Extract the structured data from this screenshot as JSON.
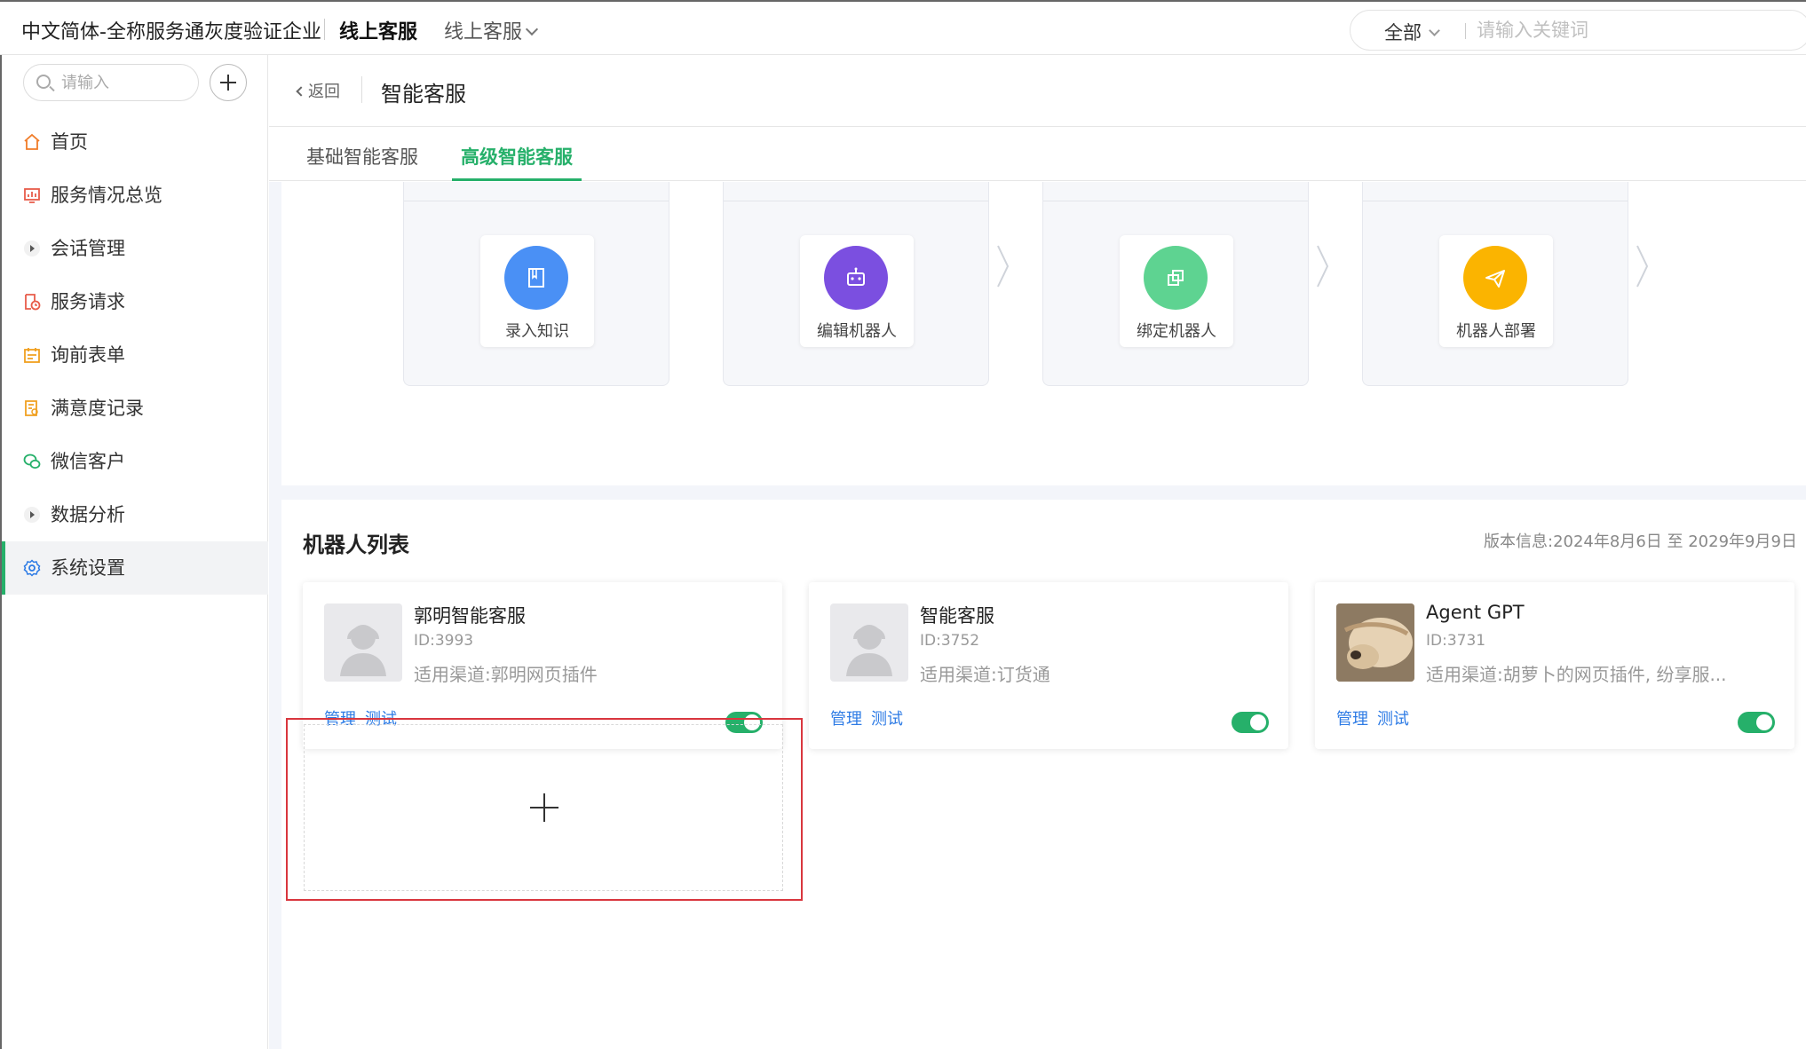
{
  "header": {
    "company": "中文简体-全称服务通灰度验证企业",
    "product": "线上客服",
    "product_switch": "线上客服",
    "scope": "全部",
    "search_placeholder": "请输入关键词"
  },
  "sidebar": {
    "search_placeholder": "请输入",
    "items": [
      {
        "label": "首页",
        "icon": "home-icon",
        "color": "#f07c28"
      },
      {
        "label": "服务情况总览",
        "icon": "dashboard-icon",
        "color": "#e85c4a"
      },
      {
        "label": "会话管理",
        "icon": "caret-right-icon",
        "color": "#555555"
      },
      {
        "label": "服务请求",
        "icon": "document-clock-icon",
        "color": "#e85c4a"
      },
      {
        "label": "询前表单",
        "icon": "calendar-form-icon",
        "color": "#f0a020"
      },
      {
        "label": "满意度记录",
        "icon": "rating-doc-icon",
        "color": "#f0a020"
      },
      {
        "label": "微信客户",
        "icon": "wechat-icon",
        "color": "#26b06a"
      },
      {
        "label": "数据分析",
        "icon": "caret-right-icon",
        "color": "#555555"
      },
      {
        "label": "系统设置",
        "icon": "gear-icon",
        "color": "#2d7be5"
      }
    ]
  },
  "page": {
    "back_label": "返回",
    "title": "智能客服",
    "tabs": [
      "基础智能客服",
      "高级智能客服"
    ],
    "active_tab": "高级智能客服"
  },
  "flow_steps": [
    {
      "label": "录入知识",
      "icon": "book-icon",
      "color": "#4a90f5"
    },
    {
      "label": "编辑机器人",
      "icon": "robot-icon",
      "color": "#7b4fe0"
    },
    {
      "label": "绑定机器人",
      "icon": "bind-icon",
      "color": "#5ed391"
    },
    {
      "label": "机器人部署",
      "icon": "send-icon",
      "color": "#fbb400"
    }
  ],
  "robot_list": {
    "title": "机器人列表",
    "version_label": "版本信息:",
    "version_range": "2024年8月6日 至 2029年9月9日",
    "robots": [
      {
        "name": "郭明智能客服",
        "id": "ID:3993",
        "channel": "适用渠道:郭明网页插件",
        "enabled": true,
        "avatar": "default-avatar-icon"
      },
      {
        "name": "智能客服",
        "id": "ID:3752",
        "channel": "适用渠道:订货通",
        "enabled": true,
        "avatar": "default-avatar-icon"
      },
      {
        "name": "Agent GPT",
        "id": "ID:3731",
        "channel": "适用渠道:胡萝卜的网页插件, 纷享服...",
        "enabled": true,
        "avatar": "dog-photo"
      }
    ],
    "manage_label": "管理",
    "test_label": "测试"
  }
}
